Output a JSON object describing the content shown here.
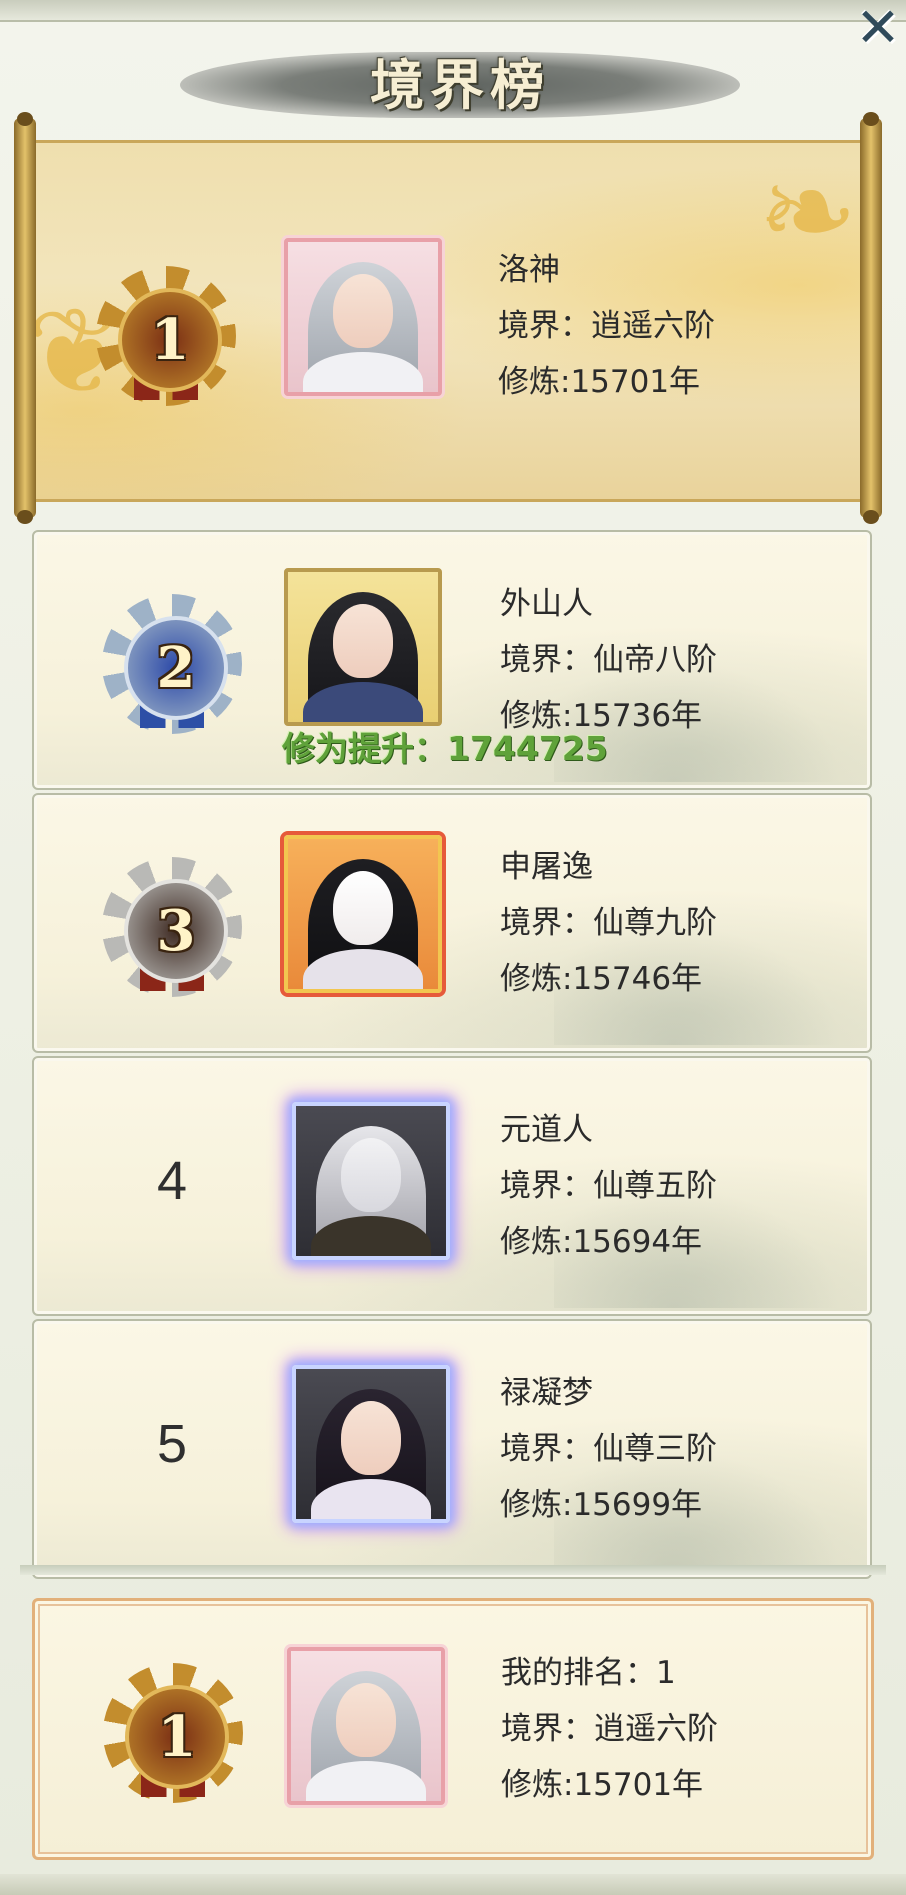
{
  "title": "境界榜",
  "close_icon": "close-icon",
  "entries": [
    {
      "rank": "1",
      "name": "洛神",
      "realm": "境界：逍遥六阶",
      "cultivation": "修炼:15701年",
      "medal": "gold"
    },
    {
      "rank": "2",
      "name": "外山人",
      "realm": "境界：仙帝八阶",
      "cultivation": "修炼:15736年",
      "medal": "blue"
    },
    {
      "rank": "3",
      "name": "申屠逸",
      "realm": "境界：仙尊九阶",
      "cultivation": "修炼:15746年",
      "medal": "silver"
    },
    {
      "rank": "4",
      "name": "元道人",
      "realm": "境界：仙尊五阶",
      "cultivation": "修炼:15694年"
    },
    {
      "rank": "5",
      "name": "禄凝梦",
      "realm": "境界：仙尊三阶",
      "cultivation": "修炼:15699年"
    }
  ],
  "floating_text": "修为提升：1744725",
  "my_rank": {
    "rank": "1",
    "label": "我的排名：1",
    "realm": "境界：逍遥六阶",
    "cultivation": "修炼:15701年"
  }
}
